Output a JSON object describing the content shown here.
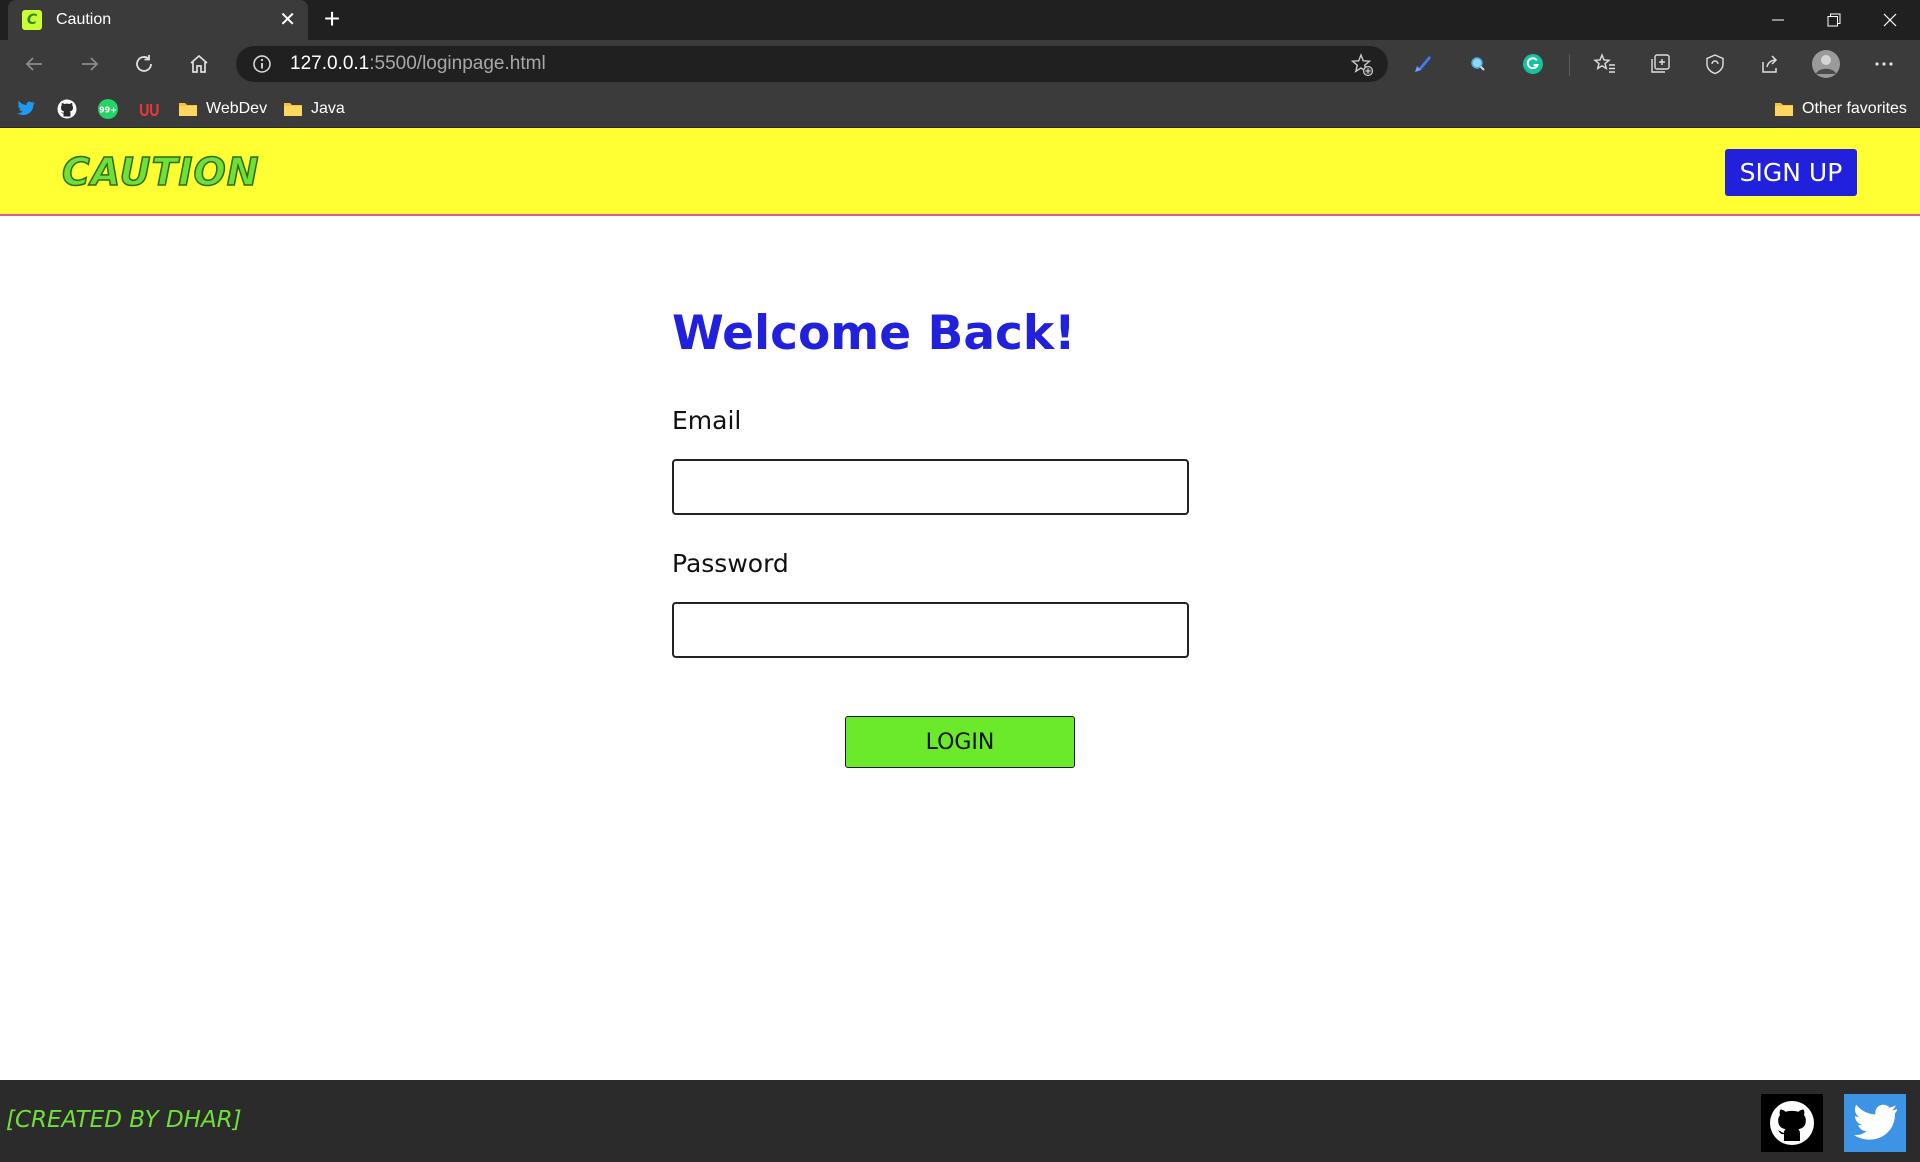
{
  "browser": {
    "tab": {
      "title": "Caution",
      "favicon_letter": "C"
    },
    "address": {
      "host": "127.0.0.1",
      "rest": ":5500/loginpage.html"
    },
    "bookmarks": [
      {
        "icon": "twitter-icon"
      },
      {
        "icon": "github-icon"
      },
      {
        "icon": "whatsapp-icon",
        "badge": "99+"
      },
      {
        "icon": "udemy-icon"
      },
      {
        "icon": "folder-icon",
        "label": "WebDev"
      },
      {
        "icon": "folder-icon",
        "label": "Java"
      }
    ],
    "other_favorites": "Other favorites"
  },
  "page": {
    "logo": "CAUTION",
    "signup_label": "SIGN UP",
    "welcome": "Welcome Back!",
    "email_label": "Email",
    "email_value": "",
    "password_label": "Password",
    "password_value": "",
    "login_label": "LOGIN",
    "credit": "[CREATED BY DHAR]",
    "colors": {
      "header_bg": "#ffff33",
      "accent_blue": "#2020dd",
      "accent_green": "#6aea2a",
      "footer_bg": "#2b2b2b"
    }
  }
}
